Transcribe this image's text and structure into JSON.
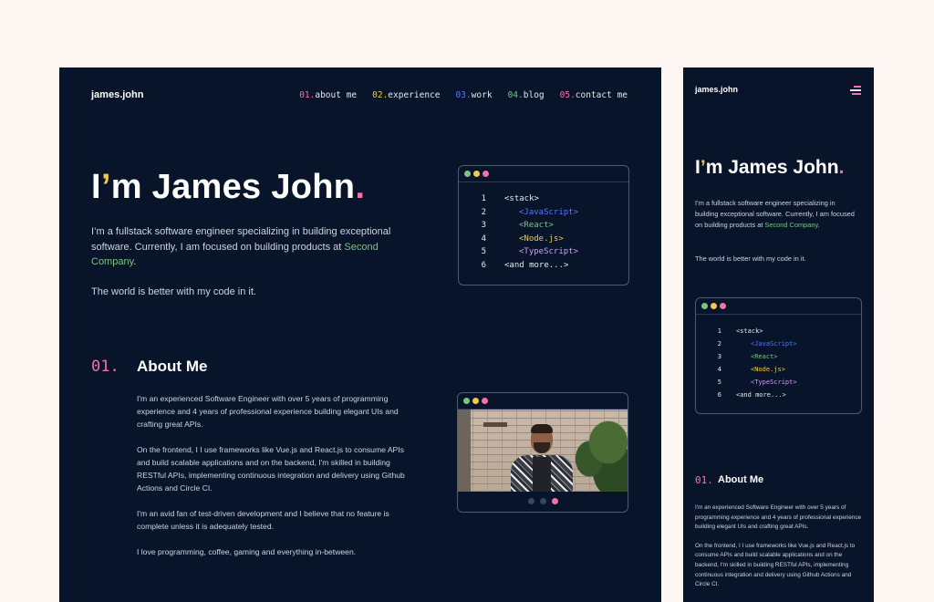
{
  "site": {
    "logo": "james.john"
  },
  "nav": [
    {
      "num": "01.",
      "label": "about me",
      "color": "#f472a6"
    },
    {
      "num": "02.",
      "label": "experience",
      "color": "#f2c94c"
    },
    {
      "num": "03.",
      "label": "work",
      "color": "#4f7cf7"
    },
    {
      "num": "04.",
      "label": "blog",
      "color": "#7cc47f"
    },
    {
      "num": "05.",
      "label": "contact me",
      "color": "#f472a6"
    }
  ],
  "hero": {
    "title_i": "I",
    "title_apos": "’",
    "title_rest": "m James John",
    "title_dot": ".",
    "intro": "I’m a fullstack software engineer specializing in building exceptional software. Currently, I am focused on building products at ",
    "company": "Second Company",
    "intro_end": ".",
    "tagline": "The world is better with my code in it."
  },
  "code": {
    "lines": [
      {
        "n": "1",
        "text": "<stack>"
      },
      {
        "n": "2",
        "text": "<JavaScript>"
      },
      {
        "n": "3",
        "text": "<React>"
      },
      {
        "n": "4",
        "text": "<Node.js>"
      },
      {
        "n": "5",
        "text": "<TypeScript>"
      },
      {
        "n": "6",
        "text": "<and more...>"
      }
    ]
  },
  "about": {
    "num": "01.",
    "title": "About Me",
    "paragraphs": [
      "I'm an experienced Software Engineer with over 5 years of programming experience and 4 years of professional experience building elegant UIs and crafting great APIs.",
      "On the frontend, I I use frameworks like Vue.js and React.js to consume APIs and build scalable applications and on the backend, I'm skilled in building RESTful APIs, implementing continuous integration and delivery using Github Actions and Circle CI.",
      "I'm an avid fan of test-driven development and I believe that no feature is complete unless it is adequately tested.",
      "I love programming, coffee, gaming and everything in-between."
    ]
  },
  "colors": {
    "background": "#fdf6f3",
    "panel": "#07142a",
    "pink": "#f472a6",
    "yellow": "#f2c94c",
    "blue": "#4f7cf7",
    "green": "#7cc47f",
    "purple": "#d59bf6"
  },
  "icons": {
    "menu": "hamburger-menu-icon"
  }
}
